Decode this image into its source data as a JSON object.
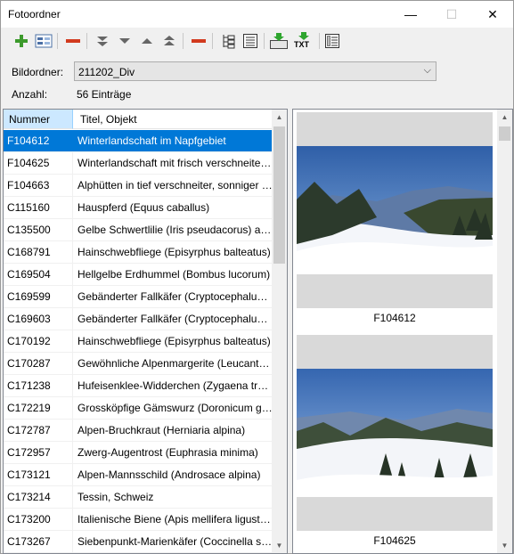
{
  "window": {
    "title": "Fotoordner",
    "minimize": "—",
    "maximize": "☐",
    "close": "✕"
  },
  "toolbar": [
    {
      "name": "add-icon"
    },
    {
      "name": "form-icon"
    },
    {
      "name": "remove-icon"
    },
    {
      "name": "move-bottom-icon"
    },
    {
      "name": "move-down-icon"
    },
    {
      "name": "move-up-icon"
    },
    {
      "name": "move-top-icon"
    },
    {
      "name": "delete-icon"
    },
    {
      "name": "tree-icon"
    },
    {
      "name": "list-icon"
    },
    {
      "name": "export-image-icon"
    },
    {
      "name": "export-txt-icon",
      "text": "TXT"
    },
    {
      "name": "report-icon"
    }
  ],
  "form": {
    "folder_label": "Bildordner:",
    "folder_value": "211202_Div",
    "folder_arrow": "⌵",
    "count_label": "Anzahl:",
    "count_value": "56 Einträge"
  },
  "list": {
    "col_number": "Nummer",
    "col_title": "Titel, Objekt",
    "rows": [
      {
        "num": "F104612",
        "title": "Winterlandschaft im Napfgebiet"
      },
      {
        "num": "F104625",
        "title": "Winterlandschaft mit frisch verschneiten Wäldern"
      },
      {
        "num": "F104663",
        "title": "Alphütten in tief verschneiter, sonniger Landschaft"
      },
      {
        "num": "C115160",
        "title": "Hauspferd (Equus caballus)"
      },
      {
        "num": "C135500",
        "title": "Gelbe Schwertlilie (Iris pseudacorus) am Teich"
      },
      {
        "num": "C168791",
        "title": "Hainschwebfliege (Episyrphus balteatus)"
      },
      {
        "num": "C169504",
        "title": "Hellgelbe Erdhummel (Bombus lucorum)"
      },
      {
        "num": "C169599",
        "title": "Gebänderter Fallkäfer (Cryptocephalus sericeus)"
      },
      {
        "num": "C169603",
        "title": "Gebänderter Fallkäfer (Cryptocephalus sericeus)"
      },
      {
        "num": "C170192",
        "title": "Hainschwebfliege (Episyrphus balteatus)"
      },
      {
        "num": "C170287",
        "title": "Gewöhnliche Alpenmargerite (Leucanthemopsis alpina)"
      },
      {
        "num": "C171238",
        "title": "Hufeisenklee-Widderchen (Zygaena transalpina)"
      },
      {
        "num": "C172219",
        "title": "Grossköpfige Gämswurz (Doronicum grandiflorum)"
      },
      {
        "num": "C172787",
        "title": "Alpen-Bruchkraut (Herniaria alpina)"
      },
      {
        "num": "C172957",
        "title": "Zwerg-Augentrost (Euphrasia minima)"
      },
      {
        "num": "C173121",
        "title": "Alpen-Mannsschild (Androsace alpina)"
      },
      {
        "num": "C173214",
        "title": "Tessin, Schweiz"
      },
      {
        "num": "C173200",
        "title": "Italienische Biene (Apis mellifera ligustica)"
      },
      {
        "num": "C173267",
        "title": "Siebenpunkt-Marienkäfer (Coccinella septempunctata)"
      }
    ],
    "selected_index": 0
  },
  "gallery": {
    "items": [
      {
        "caption": "F104612"
      },
      {
        "caption": "F104625"
      }
    ]
  },
  "scroll": {
    "up": "▲",
    "down": "▼"
  },
  "colors": {
    "selection": "#0078d7",
    "header_active": "#cce8ff"
  }
}
